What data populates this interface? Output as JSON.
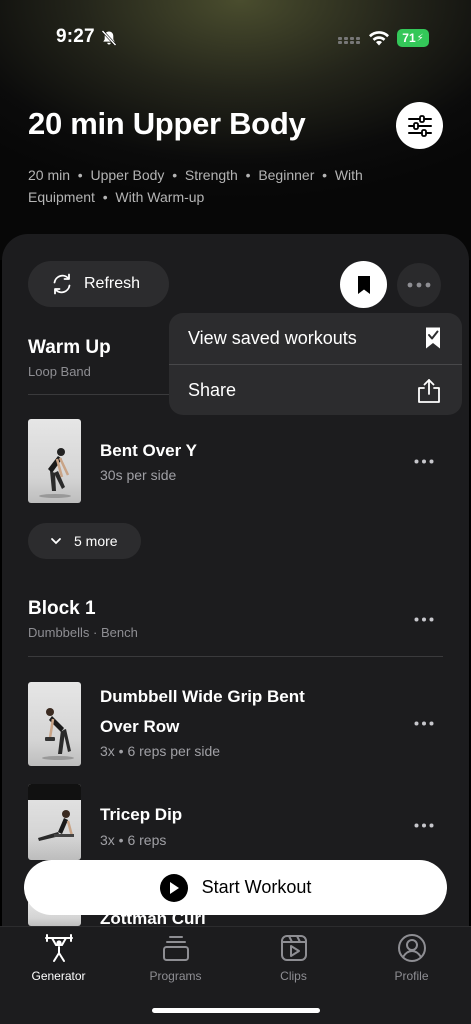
{
  "status_bar": {
    "time": "9:27",
    "battery": "71"
  },
  "header": {
    "title": "20 min Upper Body",
    "tags": [
      "20 min",
      "Upper Body",
      "Strength",
      "Beginner",
      "With Equipment",
      "With Warm-up"
    ]
  },
  "toolbar": {
    "refresh_label": "Refresh"
  },
  "menu": {
    "items": [
      {
        "label": "View saved workouts",
        "icon": "saved-check-icon"
      },
      {
        "label": "Share",
        "icon": "share-icon"
      }
    ]
  },
  "sections": {
    "warmup": {
      "title": "Warm Up",
      "equipment": "Loop Band",
      "exercises": [
        {
          "name": "Bent Over Y",
          "detail": "30s per side"
        }
      ],
      "more_label": "5 more"
    },
    "block1": {
      "title": "Block 1",
      "equipment": "Dumbbells · Bench",
      "exercises": [
        {
          "name_line1": "Dumbbell Wide Grip Bent",
          "name_line2": "Over Row",
          "detail": "3x • 6 reps per side"
        },
        {
          "name": "Tricep Dip",
          "detail": "3x • 6 reps"
        },
        {
          "name": "Zottman Curl"
        }
      ]
    }
  },
  "start_button": {
    "label": "Start Workout"
  },
  "tabbar": {
    "tabs": [
      {
        "label": "Generator",
        "icon": "weightlifter-icon",
        "active": true
      },
      {
        "label": "Programs",
        "icon": "stack-icon",
        "active": false
      },
      {
        "label": "Clips",
        "icon": "clips-play-icon",
        "active": false
      },
      {
        "label": "Profile",
        "icon": "profile-icon",
        "active": false
      }
    ]
  },
  "colors": {
    "accent_battery": "#34c759",
    "card": "#1c1c1e",
    "pill": "#2c2c2e"
  }
}
